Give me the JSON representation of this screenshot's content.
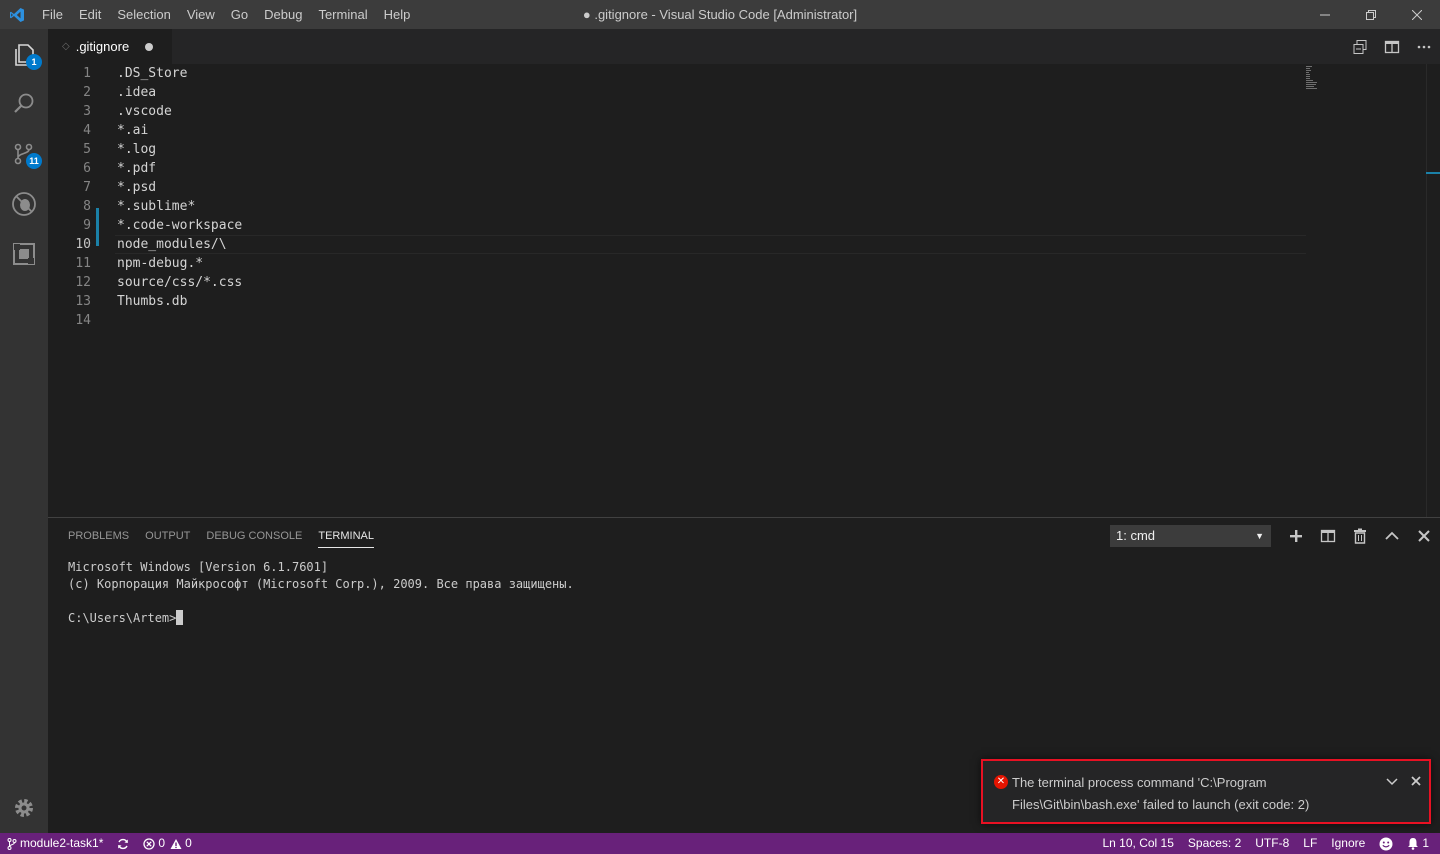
{
  "window": {
    "title": "● .gitignore - Visual Studio Code [Administrator]",
    "menu": [
      "File",
      "Edit",
      "Selection",
      "View",
      "Go",
      "Debug",
      "Terminal",
      "Help"
    ]
  },
  "activity_bar": {
    "explorer_badge": "1",
    "scm_badge": "11"
  },
  "editor": {
    "tab": {
      "label": ".gitignore",
      "dirty": true
    },
    "active_line": "10",
    "lines": [
      {
        "n": "1",
        "text": ".DS_Store"
      },
      {
        "n": "2",
        "text": ".idea"
      },
      {
        "n": "3",
        "text": ".vscode"
      },
      {
        "n": "4",
        "text": "*.ai"
      },
      {
        "n": "5",
        "text": "*.log"
      },
      {
        "n": "6",
        "text": "*.pdf"
      },
      {
        "n": "7",
        "text": "*.psd"
      },
      {
        "n": "8",
        "text": "*.sublime*"
      },
      {
        "n": "9",
        "text": "*.code-workspace"
      },
      {
        "n": "10",
        "text": "node_modules/\\"
      },
      {
        "n": "11",
        "text": "npm-debug.*"
      },
      {
        "n": "12",
        "text": "source/css/*.css"
      },
      {
        "n": "13",
        "text": "Thumbs.db"
      },
      {
        "n": "14",
        "text": ""
      }
    ]
  },
  "panel": {
    "tabs": [
      "PROBLEMS",
      "OUTPUT",
      "DEBUG CONSOLE",
      "TERMINAL"
    ],
    "active_tab": "TERMINAL",
    "terminal_select": "1: cmd",
    "terminal_lines": [
      "Microsoft Windows [Version 6.1.7601]",
      "(c) Корпорация Майкрософт (Microsoft Corp.), 2009. Все права защищены.",
      "",
      "C:\\Users\\Artem>"
    ]
  },
  "notification": {
    "line1": "The terminal process command 'C:\\Program",
    "line2": "Files\\Git\\bin\\bash.exe' failed to launch (exit code: 2)",
    "severity": "error"
  },
  "status_bar": {
    "branch": "module2-task1*",
    "errors": "0",
    "warnings": "0",
    "position": "Ln 10, Col 15",
    "spaces": "Spaces: 2",
    "encoding": "UTF-8",
    "eol": "LF",
    "language": "Ignore",
    "notifications": "1",
    "color": "#68217a"
  }
}
